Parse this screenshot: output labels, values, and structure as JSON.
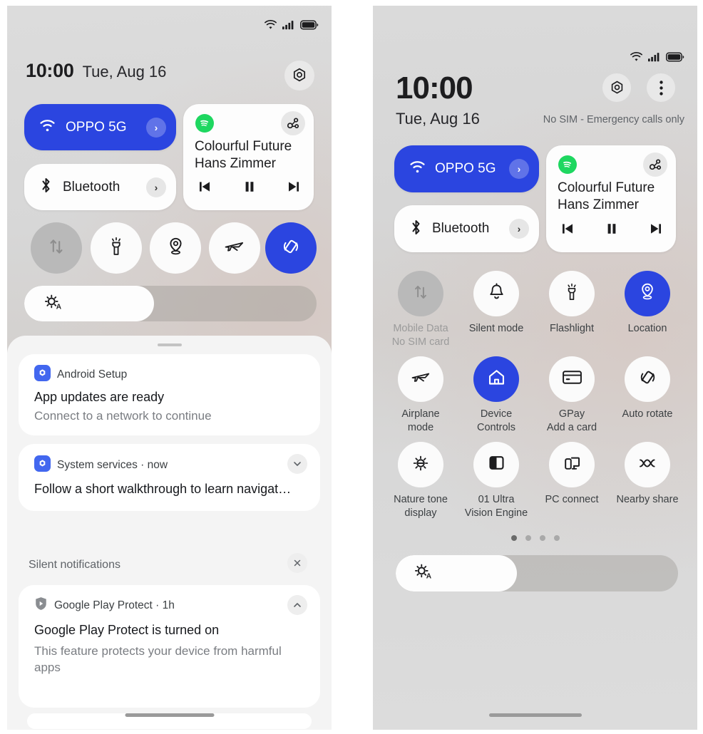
{
  "left_panel": {
    "statusbar": {
      "wifi_icon": "wifi-icon",
      "signal_icon": "signal-icon",
      "battery_icon": "battery-icon"
    },
    "header": {
      "time": "10:00",
      "date": "Tue, Aug 16",
      "settings_icon": "gear-icon"
    },
    "connectivity": [
      {
        "name": "wifi",
        "label": "OPPO 5G",
        "icon": "wifi-icon",
        "state": "on",
        "chevron": "›"
      },
      {
        "name": "bluetooth",
        "label": "Bluetooth",
        "icon": "bluetooth-icon",
        "state": "off",
        "chevron": "›"
      }
    ],
    "media": {
      "app_icon": "spotify-icon",
      "cast_icon": "cast-output-icon",
      "title": "Colourful Future",
      "artist": "Hans Zimmer",
      "controls": [
        "previous-icon",
        "pause-icon",
        "next-icon"
      ]
    },
    "toggles": [
      {
        "name": "mobile-data",
        "icon": "mobile-data-icon",
        "state": "disabled"
      },
      {
        "name": "flashlight",
        "icon": "flashlight-icon",
        "state": "off"
      },
      {
        "name": "location",
        "icon": "location-icon",
        "state": "off"
      },
      {
        "name": "airplane-mode",
        "icon": "airplane-icon",
        "state": "off"
      },
      {
        "name": "auto-rotate",
        "icon": "auto-rotate-icon",
        "state": "on"
      }
    ],
    "brightness": {
      "icon": "auto-brightness-icon",
      "value_percent": 45
    },
    "notifications": [
      {
        "app": "Android Setup",
        "app_icon": "android-setup-icon",
        "title": "App updates are ready",
        "body": "Connect to a network to continue",
        "action_icon": null
      },
      {
        "app": "System services · now",
        "app_icon": "system-services-icon",
        "title": "Follow a short walkthrough to learn navigat…",
        "body": null,
        "action_icon": "chevron-down-icon"
      }
    ],
    "silent_section": {
      "label": "Silent notifications",
      "clear_icon": "close-icon",
      "notifications": [
        {
          "app": "Google Play Protect · 1h",
          "app_icon": "play-protect-icon",
          "title": "Google Play Protect is turned on",
          "body": "This feature protects  your device from harmful apps",
          "action_icon": "chevron-up-icon"
        }
      ]
    }
  },
  "right_panel": {
    "statusbar": {
      "wifi_icon": "wifi-icon",
      "signal_icon": "signal-icon",
      "battery_icon": "battery-icon"
    },
    "header": {
      "time": "10:00",
      "date": "Tue, Aug 16",
      "sim_status": "No SIM - Emergency calls only",
      "settings_icon": "gear-icon",
      "overflow_icon": "more-vertical-icon"
    },
    "connectivity": [
      {
        "name": "wifi",
        "label": "OPPO 5G",
        "icon": "wifi-icon",
        "state": "on",
        "chevron": "›"
      },
      {
        "name": "bluetooth",
        "label": "Bluetooth",
        "icon": "bluetooth-icon",
        "state": "off",
        "chevron": "›"
      }
    ],
    "media": {
      "app_icon": "spotify-icon",
      "cast_icon": "cast-output-icon",
      "title": "Colourful Future",
      "artist": "Hans Zimmer",
      "controls": [
        "previous-icon",
        "pause-icon",
        "next-icon"
      ]
    },
    "tiles": [
      {
        "name": "mobile-data",
        "icon": "mobile-data-icon",
        "label_line1": "Mobile Data",
        "label_line2": "No SIM card",
        "state": "disabled"
      },
      {
        "name": "silent-mode",
        "icon": "bell-icon",
        "label_line1": "Silent mode",
        "label_line2": "",
        "state": "off"
      },
      {
        "name": "flashlight",
        "icon": "flashlight-icon",
        "label_line1": "Flashlight",
        "label_line2": "",
        "state": "off"
      },
      {
        "name": "location",
        "icon": "location-icon",
        "label_line1": "Location",
        "label_line2": "",
        "state": "on"
      },
      {
        "name": "airplane-mode",
        "icon": "airplane-icon",
        "label_line1": "Airplane",
        "label_line2": "mode",
        "state": "off"
      },
      {
        "name": "device-controls",
        "icon": "home-icon",
        "label_line1": "Device",
        "label_line2": "Controls",
        "state": "on"
      },
      {
        "name": "gpay",
        "icon": "card-icon",
        "label_line1": "GPay",
        "label_line2": "Add a card",
        "state": "off"
      },
      {
        "name": "auto-rotate",
        "icon": "auto-rotate-icon",
        "label_line1": "Auto rotate",
        "label_line2": "",
        "state": "off"
      },
      {
        "name": "nature-tone-display",
        "icon": "sun-icon",
        "label_line1": "Nature tone",
        "label_line2": "display",
        "state": "off"
      },
      {
        "name": "ultra-vision-engine",
        "icon": "split-square-icon",
        "label_line1": "01 Ultra",
        "label_line2": "Vision Engine",
        "state": "off"
      },
      {
        "name": "pc-connect",
        "icon": "pc-connect-icon",
        "label_line1": "PC connect",
        "label_line2": "",
        "state": "off"
      },
      {
        "name": "nearby-share",
        "icon": "nearby-share-icon",
        "label_line1": "Nearby share",
        "label_line2": "",
        "state": "off"
      }
    ],
    "page_dots": {
      "count": 4,
      "active_index": 0
    },
    "brightness": {
      "icon": "auto-brightness-icon",
      "value_percent": 39
    }
  },
  "colors": {
    "accent_blue": "#2b45e0",
    "spotify_green": "#1ed760",
    "tile_off": "#fbfbfb",
    "tile_disabled": "#b9b9b9",
    "text_primary": "#1c1c1e",
    "text_secondary": "#5f6368",
    "shade_bg": "#f4f4f4"
  }
}
